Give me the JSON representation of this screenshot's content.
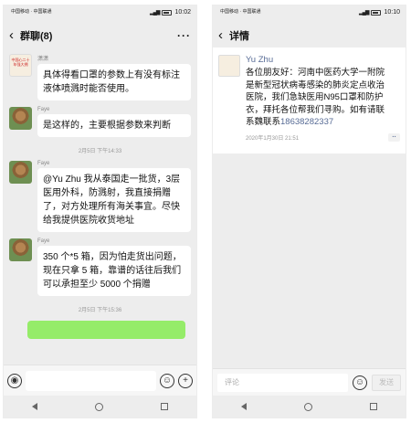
{
  "left": {
    "status": {
      "carrier": "中国移动 · 中国联通",
      "time": "10:02",
      "battery": "▮"
    },
    "header": {
      "back": "‹",
      "title": "群聊(8)",
      "more": "···"
    },
    "messages": [
      {
        "name": "潇潇",
        "text": "具体得看口罩的参数上有没有标注液体喷溅时能否使用。",
        "avatar": "poster"
      },
      {
        "name": "Faye",
        "text": "是这样的，主要根据参数来判断",
        "avatar": "dog"
      },
      {
        "name": "Faye",
        "text": "@Yu Zhu 我从泰国走一批货，3层医用外科，防溅射，我直接捐赠了，对方处理所有海关事宜。尽快给我提供医院收货地址",
        "avatar": "dog"
      },
      {
        "name": "Faye",
        "text": "350 个*5 箱，因为怕走货出问题，现在只拿 5 箱，靠谱的话往后我们可以承担至少 5000 个捐赠",
        "avatar": "dog"
      }
    ],
    "times": [
      "2月5日 下午14:33",
      "2月5日 下午15:36"
    ],
    "input": {
      "voice": "◉",
      "emoji": "☺",
      "plus": "+"
    },
    "poster_text": "中国心二十 年强大拥"
  },
  "right": {
    "status": {
      "carrier": "中国移动 · 中国联通",
      "time": "10:10"
    },
    "header": {
      "back": "‹",
      "title": "详情"
    },
    "post": {
      "name": "Yu Zhu",
      "text": "各位朋友好：河南中医药大学一附院是新型冠状病毒感染的肺炎定点收治医院，我们急缺医用N95口罩和防护衣，拜托各位帮我们寻购。如有请联系魏联系",
      "phone": "18638282337",
      "time": "2020年1月30日 21:51",
      "dots": "··"
    },
    "comment": {
      "placeholder": "评论",
      "send": "发送"
    }
  }
}
